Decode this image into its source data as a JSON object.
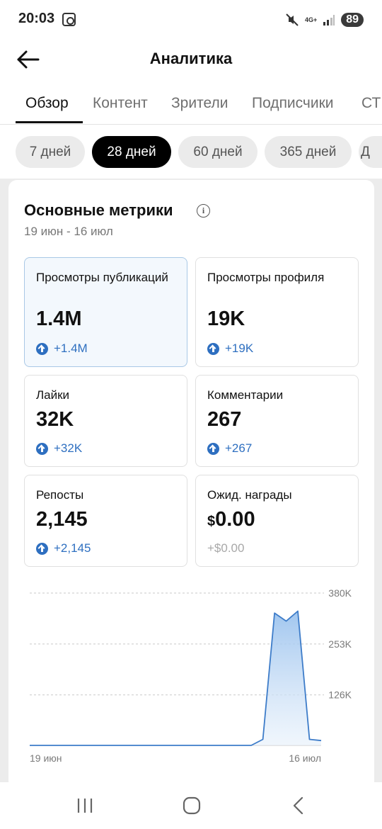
{
  "status_bar": {
    "time": "20:03",
    "network": "4G+",
    "battery": "89"
  },
  "header": {
    "title": "Аналитика"
  },
  "tabs": [
    {
      "label": "Обзор",
      "active": true
    },
    {
      "label": "Контент"
    },
    {
      "label": "Зрители"
    },
    {
      "label": "Подписчики"
    },
    {
      "label": "СТ"
    }
  ],
  "ranges": [
    {
      "label": "7 дней"
    },
    {
      "label": "28 дней",
      "active": true
    },
    {
      "label": "60 дней"
    },
    {
      "label": "365 дней"
    },
    {
      "label": "Д"
    }
  ],
  "metrics_section": {
    "title": "Основные метрики",
    "date_range": "19 июн - 16 июл",
    "cards": [
      {
        "label": "Просмотры публикаций",
        "value": "1.4M",
        "delta": "+1.4M",
        "selected": true
      },
      {
        "label": "Просмотры профиля",
        "value": "19K",
        "delta": "+19K"
      },
      {
        "label": "Лайки",
        "value": "32K",
        "delta": "+32K"
      },
      {
        "label": "Комментарии",
        "value": "267",
        "delta": "+267"
      },
      {
        "label": "Репосты",
        "value": "2,145",
        "delta": "+2,145"
      },
      {
        "label": "Ожид. награды",
        "value_currency": "$",
        "value": "0.00",
        "delta": "+$0.00"
      }
    ]
  },
  "chart_data": {
    "type": "area",
    "x_start_label": "19 июн",
    "x_end_label": "16 июл",
    "ylim": [
      0,
      380000
    ],
    "y_ticks": [
      {
        "value": 126000,
        "label": "126K"
      },
      {
        "value": 253000,
        "label": "253K"
      },
      {
        "value": 380000,
        "label": "380K"
      }
    ],
    "grid": true,
    "series": [
      {
        "values": [
          0,
          0,
          0,
          0,
          0,
          0,
          0,
          0,
          0,
          0,
          0,
          0,
          0,
          0,
          0,
          0,
          0,
          0,
          0,
          0,
          15000,
          330000,
          310000,
          335000,
          15000,
          12000
        ],
        "color": "#3d7cc9"
      }
    ]
  }
}
